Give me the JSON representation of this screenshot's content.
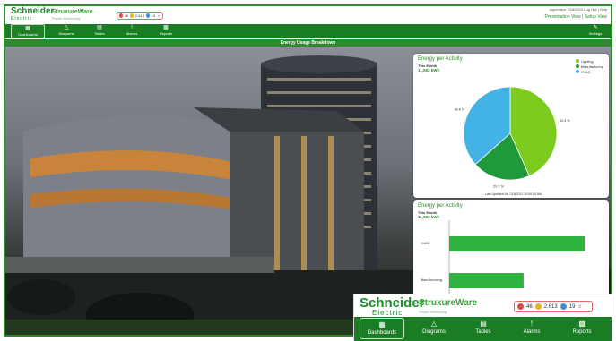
{
  "brand": {
    "name": "Schneider",
    "tagline": "Electric",
    "product": "StruxureWare",
    "product_sub": "Power Monitoring"
  },
  "alarms": {
    "high": "46",
    "medium": "2,613",
    "low": "19"
  },
  "top_right": {
    "user_line": "supervisor   7/18/2012   Log Out | Help",
    "presentation_view": "Presentation View",
    "setup_view": "Setup View"
  },
  "nav": [
    {
      "label": "Dashboards",
      "icon": "dashboards-icon"
    },
    {
      "label": "Diagrams",
      "icon": "diagrams-icon"
    },
    {
      "label": "Tables",
      "icon": "tables-icon"
    },
    {
      "label": "Alarms",
      "icon": "alarms-icon"
    },
    {
      "label": "Reports",
      "icon": "reports-icon"
    }
  ],
  "settings_label": "Settings",
  "page_title": "Energy Usage Breakdown",
  "pie_panel": {
    "title": "Energy per Activity",
    "period": "This Month",
    "total": "11,083 kWh",
    "updated": "Last Updated At: 7/18/2012 10:00:00 AM",
    "legend": [
      "Lighting",
      "Manufacturing",
      "HVAC"
    ]
  },
  "bar_panel": {
    "title": "Energy per Activity",
    "period": "This Month",
    "total": "11,083 kWh"
  },
  "chart_data": [
    {
      "type": "pie",
      "title": "Energy per Activity",
      "categories": [
        "Lighting",
        "Manufacturing",
        "HVAC"
      ],
      "values": [
        43.3,
        20.1,
        36.6
      ],
      "value_labels": [
        "43.3 %",
        "20.1 %",
        "36.6 %"
      ],
      "colors": [
        "#7ecb1f",
        "#1f9a3a",
        "#43b3e6"
      ],
      "legend_position": "top-right"
    },
    {
      "type": "bar",
      "orientation": "horizontal",
      "title": "Energy per Activity",
      "categories": [
        "HVAC",
        "Manufacturing"
      ],
      "values": [
        36.6,
        20.1
      ],
      "color": "#2eb33e"
    }
  ],
  "colors": {
    "brand_green": "#1a7d24",
    "alarm_red": "#e04848",
    "alarm_yellow": "#f2b01e",
    "alarm_blue": "#3c8fd6"
  }
}
